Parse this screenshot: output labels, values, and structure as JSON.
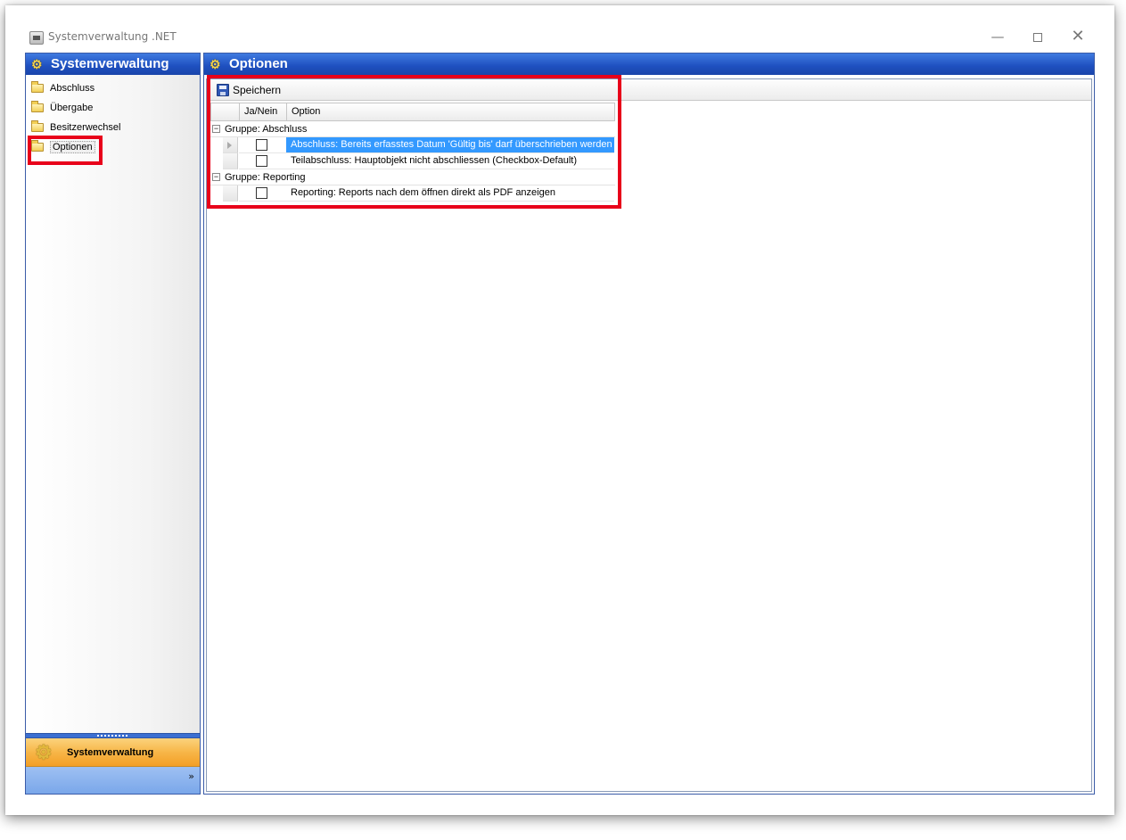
{
  "window": {
    "title": "Systemverwaltung .NET",
    "minimize_glyph": "—",
    "close_glyph": "✕"
  },
  "nav": {
    "header": "Systemverwaltung",
    "items": [
      {
        "label": "Abschluss"
      },
      {
        "label": "Übergabe"
      },
      {
        "label": "Besitzerwechsel"
      },
      {
        "label": "Optionen"
      }
    ],
    "selected": "Optionen",
    "group_button": "Systemverwaltung",
    "chevron": "»"
  },
  "main": {
    "header": "Optionen",
    "toolbar": {
      "save_label": "Speichern"
    },
    "grid": {
      "columns": [
        "Ja/Nein",
        "Option"
      ],
      "groups": [
        {
          "label": "Gruppe:  Abschluss",
          "rows": [
            {
              "checked": false,
              "option": "Abschluss: Bereits erfasstes Datum 'Gültig bis' darf überschrieben werden",
              "selected": true
            },
            {
              "checked": false,
              "option": "Teilabschluss: Hauptobjekt nicht abschliessen (Checkbox-Default)",
              "selected": false
            }
          ]
        },
        {
          "label": "Gruppe:  Reporting",
          "rows": [
            {
              "checked": false,
              "option": "Reporting: Reports nach dem öffnen direkt als PDF anzeigen",
              "selected": false
            }
          ]
        }
      ]
    }
  },
  "colors": {
    "header_blue": "#1e4fbf",
    "highlight_red": "#e8001a",
    "selection_blue": "#3399ff",
    "group_button_orange": "#f7b648"
  },
  "icons": {
    "collapse": "−",
    "gear": "⚙"
  }
}
